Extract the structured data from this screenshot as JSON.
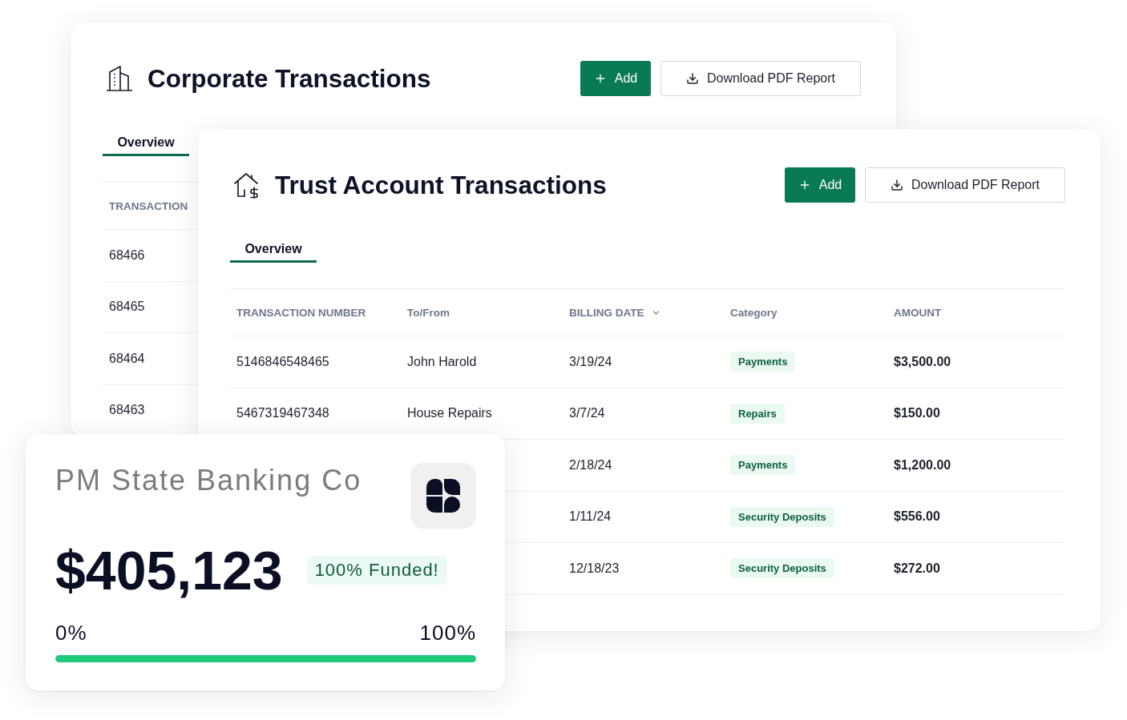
{
  "corporate_card": {
    "title": "Corporate Transactions",
    "buttons": [
      {
        "kind": "primary",
        "label": "Add"
      },
      {
        "kind": "secondary",
        "label": "Download PDF Report"
      }
    ],
    "tabs": [
      {
        "label": "Overview",
        "selected": true
      }
    ],
    "table": {
      "columns": [
        {
          "label": "TRANSACTION",
          "sorted": false
        }
      ],
      "rows": [
        {
          "transaction_number": "68466"
        },
        {
          "transaction_number": "68465"
        },
        {
          "transaction_number": "68464"
        },
        {
          "transaction_number": "68463"
        }
      ]
    }
  },
  "trust_card": {
    "title": "Trust Account Transactions",
    "buttons": [
      {
        "kind": "primary",
        "label": "Add"
      },
      {
        "kind": "secondary",
        "label": "Download PDF Report"
      }
    ],
    "tabs": [
      {
        "label": "Overview",
        "selected": true
      }
    ],
    "table": {
      "columns": [
        {
          "label": "TRANSACTION NUMBER",
          "sorted": false
        },
        {
          "label": "To/From",
          "sorted": false
        },
        {
          "label": "BILLING DATE",
          "sorted": true
        },
        {
          "label": "Category",
          "sorted": false
        },
        {
          "label": "AMOUNT",
          "sorted": false
        }
      ],
      "rows": [
        {
          "transaction_number": "5146846548465",
          "to_from": "John Harold",
          "billing_date": "3/19/24",
          "category": "Payments",
          "amount": "$3,500.00"
        },
        {
          "transaction_number": "5467319467348",
          "to_from": "House Repairs",
          "billing_date": "3/7/24",
          "category": "Repairs",
          "amount": "$150.00"
        },
        {
          "billing_date": "2/18/24",
          "category": "Payments",
          "amount": "$1,200.00"
        },
        {
          "billing_date": "1/11/24",
          "category": "Security Deposits",
          "amount": "$556.00"
        },
        {
          "billing_date": "12/18/23",
          "category": "Security Deposits",
          "amount": "$272.00"
        }
      ]
    }
  },
  "bank_card": {
    "title": "PM State Banking Co",
    "amount": "$405,123",
    "badge": "100% Funded!",
    "scale_start": "0%",
    "scale_end": "100%",
    "progress": {
      "level": 1
    }
  }
}
